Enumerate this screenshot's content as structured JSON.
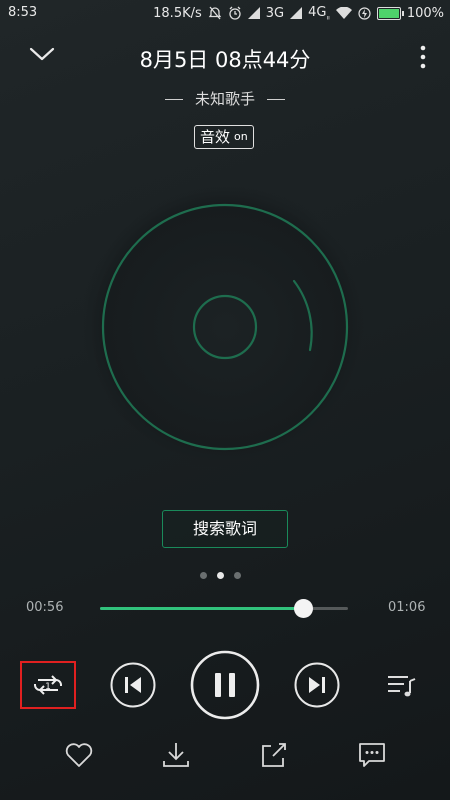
{
  "status_bar": {
    "time": "8:53",
    "net_speed": "18.5K/s",
    "network_3g": "3G",
    "network_4g": "4G",
    "network_4g_sub": "ıı",
    "battery_percent": "100%",
    "icons": [
      "mute-icon",
      "alarm-icon",
      "signal-icon",
      "signal-icon",
      "wifi-icon",
      "charging-icon",
      "battery-icon"
    ]
  },
  "header": {
    "title": "8月5日 08点44分",
    "artist": "未知歌手",
    "effect_label": "音效",
    "effect_state": "on"
  },
  "lyrics_button": "搜索歌词",
  "page_indicator": {
    "count": 3,
    "active": 2
  },
  "progress": {
    "current": "00:56",
    "total": "01:06",
    "fraction": 0.82
  },
  "controls": {
    "repeat_mode": "single-repeat",
    "repeat_badge": "1",
    "state": "playing"
  },
  "colors": {
    "accent": "#31c27c",
    "highlight_box": "#e02020",
    "disc_stroke": "#1e6d4e"
  }
}
